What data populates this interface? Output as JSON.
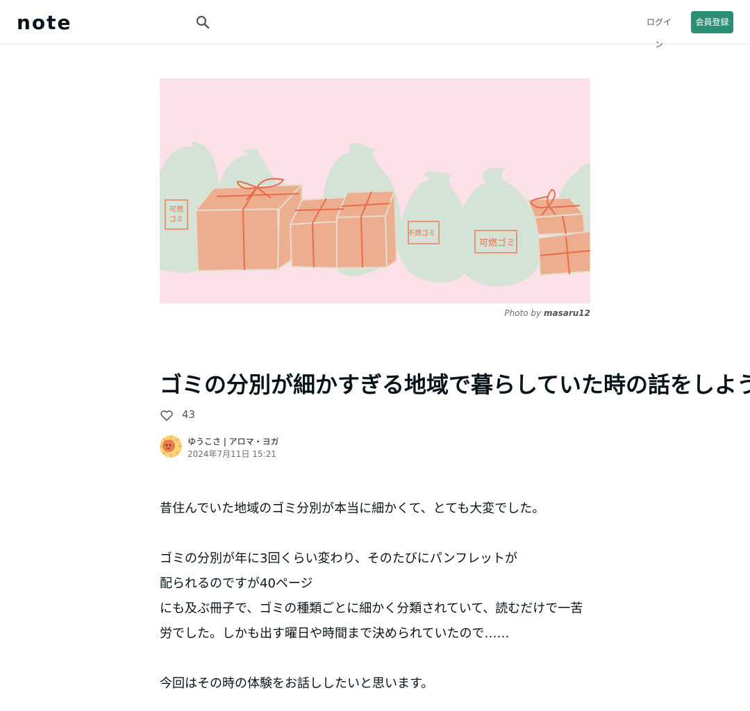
{
  "header": {
    "logo_text": "note",
    "search_icon": "search-icon",
    "login_label": "ログイン",
    "signup_label": "会員登録"
  },
  "hero": {
    "image_labels": [
      "可燃ゴミ",
      "不燃ゴミ",
      "可燃ゴミ"
    ],
    "credit_prefix": "Photo by",
    "credit_author": "masaru12",
    "colors": {
      "background": "#fde1e8",
      "bag": "#d5e3d7",
      "box": "#ecae8f",
      "ribbon": "#e86c4a"
    }
  },
  "article": {
    "title": "ゴミの分別が細かすぎる地域で暮らしていた時の話をしよう",
    "like_count": "43",
    "author": "ゆうこさ | アロマ・ヨガ",
    "date": "2024年7月11日 15:21",
    "paragraphs": [
      "昔住んでいた地域のゴミ分別が本当に細かくて、とても大変でした。",
      "ゴミの分別が年に3回くらい変わり、そのたびにパンフレットが",
      "配られるのですが40ページ",
      "にも及ぶ冊子で、ゴミの種類ごとに細かく分類されていて、読むだけで一苦労でした。しかも出す曜日や時間まで決められていたので……",
      "今回はその時の体験をお話ししたいと思います。"
    ]
  },
  "colors": {
    "accent": "#2a8f75",
    "text": "#08131a",
    "muted": "#6d6d6d"
  }
}
